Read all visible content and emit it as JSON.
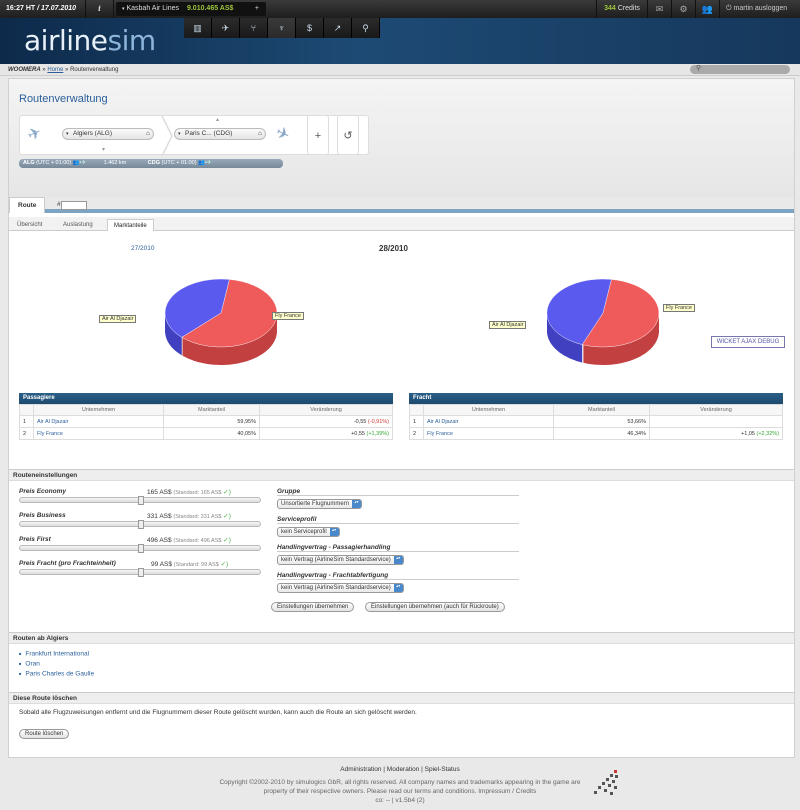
{
  "topbar": {
    "time": "16:27 HT",
    "date": "/ 17.07.2010",
    "info_icon": "i",
    "airline_name": "Kasbah Air Lines",
    "balance": "9.010.465 AS$",
    "plus": "+",
    "credits_value": "344",
    "credits_label": "Credits",
    "user_name": "martin ausloggen"
  },
  "header": {
    "logo_a": "airline",
    "logo_b": "sim"
  },
  "nav_icons": [
    "building-icon",
    "plane-icon",
    "seat-icon",
    "tower-icon",
    "dollar-icon",
    "trend-icon",
    "pin-icon"
  ],
  "breadcrumb": {
    "root": "WOOMERA",
    "sep1": "»",
    "home": "Home",
    "sep2": "»",
    "current": "Routenverwaltung"
  },
  "page_title": "Routenverwaltung",
  "planner": {
    "from_airport": "Algiers (ALG)",
    "to_airport": "Paris C... (CDG)",
    "add": "+",
    "undo": "↺"
  },
  "route_bar": {
    "from_code": "ALG",
    "from_tz": "(UTC + 01:00)",
    "distance": "1.462 km",
    "to_code": "CDG",
    "to_tz": "(UTC + 01:00)"
  },
  "tabs": {
    "route": "Route",
    "hash": "#"
  },
  "subtabs": [
    "Übersicht",
    "Auslastung",
    "Marktanteile"
  ],
  "periods": {
    "prev": "27/2010",
    "current": "28/2010"
  },
  "colors": {
    "red": "#ef5a5a",
    "blue": "#5a5aef",
    "header": "#1d4a74"
  },
  "chart_data": [
    {
      "type": "pie",
      "name": "Passagiere",
      "categories": [
        "Air Al Djazair",
        "Fly France"
      ],
      "values": [
        59.95,
        40.05
      ]
    },
    {
      "type": "pie",
      "name": "Fracht",
      "categories": [
        "Air Al Djazair",
        "Fly France"
      ],
      "values": [
        53.66,
        46.34
      ]
    }
  ],
  "passengers": {
    "title": "Passagiere",
    "headers": [
      "Unternehmen",
      "Marktanteil",
      "Veränderung"
    ],
    "rows": [
      {
        "rank": "1",
        "company": "Air Al Djazair",
        "share": "59,95%",
        "change": "-0,55",
        "change_pct": "(-0,91%)"
      },
      {
        "rank": "2",
        "company": "Fly France",
        "share": "40,05%",
        "change": "+0,55",
        "change_pct": "(+1,39%)"
      }
    ]
  },
  "freight": {
    "title": "Fracht",
    "headers": [
      "Unternehmen",
      "Marktanteil",
      "Veränderung"
    ],
    "rows": [
      {
        "rank": "1",
        "company": "Air Al Djazair",
        "share": "53,66%",
        "change": "",
        "change_pct": ""
      },
      {
        "rank": "2",
        "company": "Fly France",
        "share": "46,34%",
        "change": "+1,05",
        "change_pct": "(+2,32%)"
      }
    ]
  },
  "wicket_debug": "WICKET AJAX DEBUG",
  "settings": {
    "title": "Routeneinstellungen",
    "prices": [
      {
        "label": "Preis Economy",
        "value": "165",
        "unit": "AS$",
        "std": "(Standard: 165 AS$",
        "level": 0.5
      },
      {
        "label": "Preis Business",
        "value": "331",
        "unit": "AS$",
        "std": "(Standard: 331 AS$",
        "level": 0.5
      },
      {
        "label": "Preis First",
        "value": "496",
        "unit": "AS$",
        "std": "(Standard: 496 AS$",
        "level": 0.5
      },
      {
        "label": "Preis Fracht (pro Frachteinheit)",
        "value": "99",
        "unit": "AS$",
        "std": "(Standard: 99 AS$",
        "level": 0.5
      }
    ],
    "check": "✓)",
    "group_label": "Gruppe",
    "group_value": "Unsortierte Flugnummern",
    "service_label": "Serviceprofil",
    "service_value": "kein Serviceprofil",
    "pax_handling_label": "Handlingvertrag - Passagierhandling",
    "pax_handling_value": "kein Vertrag (AirlineSim Standardservice)",
    "cargo_handling_label": "Handlingvertrag - Frachtabfertigung",
    "cargo_handling_value": "kein Vertrag (AirlineSim Standardservice)",
    "apply": "Einstellungen übernehmen",
    "apply_return": "Einstellungen übernehmen (auch für Rückroute)"
  },
  "routes_from": {
    "title": "Routen ab Algiers",
    "items": [
      "Frankfurt International",
      "Oran",
      "Paris Charles de Gaulle"
    ]
  },
  "delete_route": {
    "title": "Diese Route löschen",
    "text": "Sobald alle Flugzuweisungen entfernt und die Flugnummern dieser Route gelöscht wurden, kann auch die Route an sich gelöscht werden.",
    "button": "Route löschen"
  },
  "footer": {
    "link_admin": "Administration",
    "link_moderation": "Moderation",
    "link_status": "Spiel-Status",
    "sep": "|",
    "copy1": "Copyright ©2002-2010 by simulogics GbR, all rights reserved. All company names and trademarks appearing in the game are",
    "copy2": "property of their respective owners. Please read our terms and conditions. Impressum / Credits",
    "copy3": "co: -- | v1.5b4 (2)"
  }
}
